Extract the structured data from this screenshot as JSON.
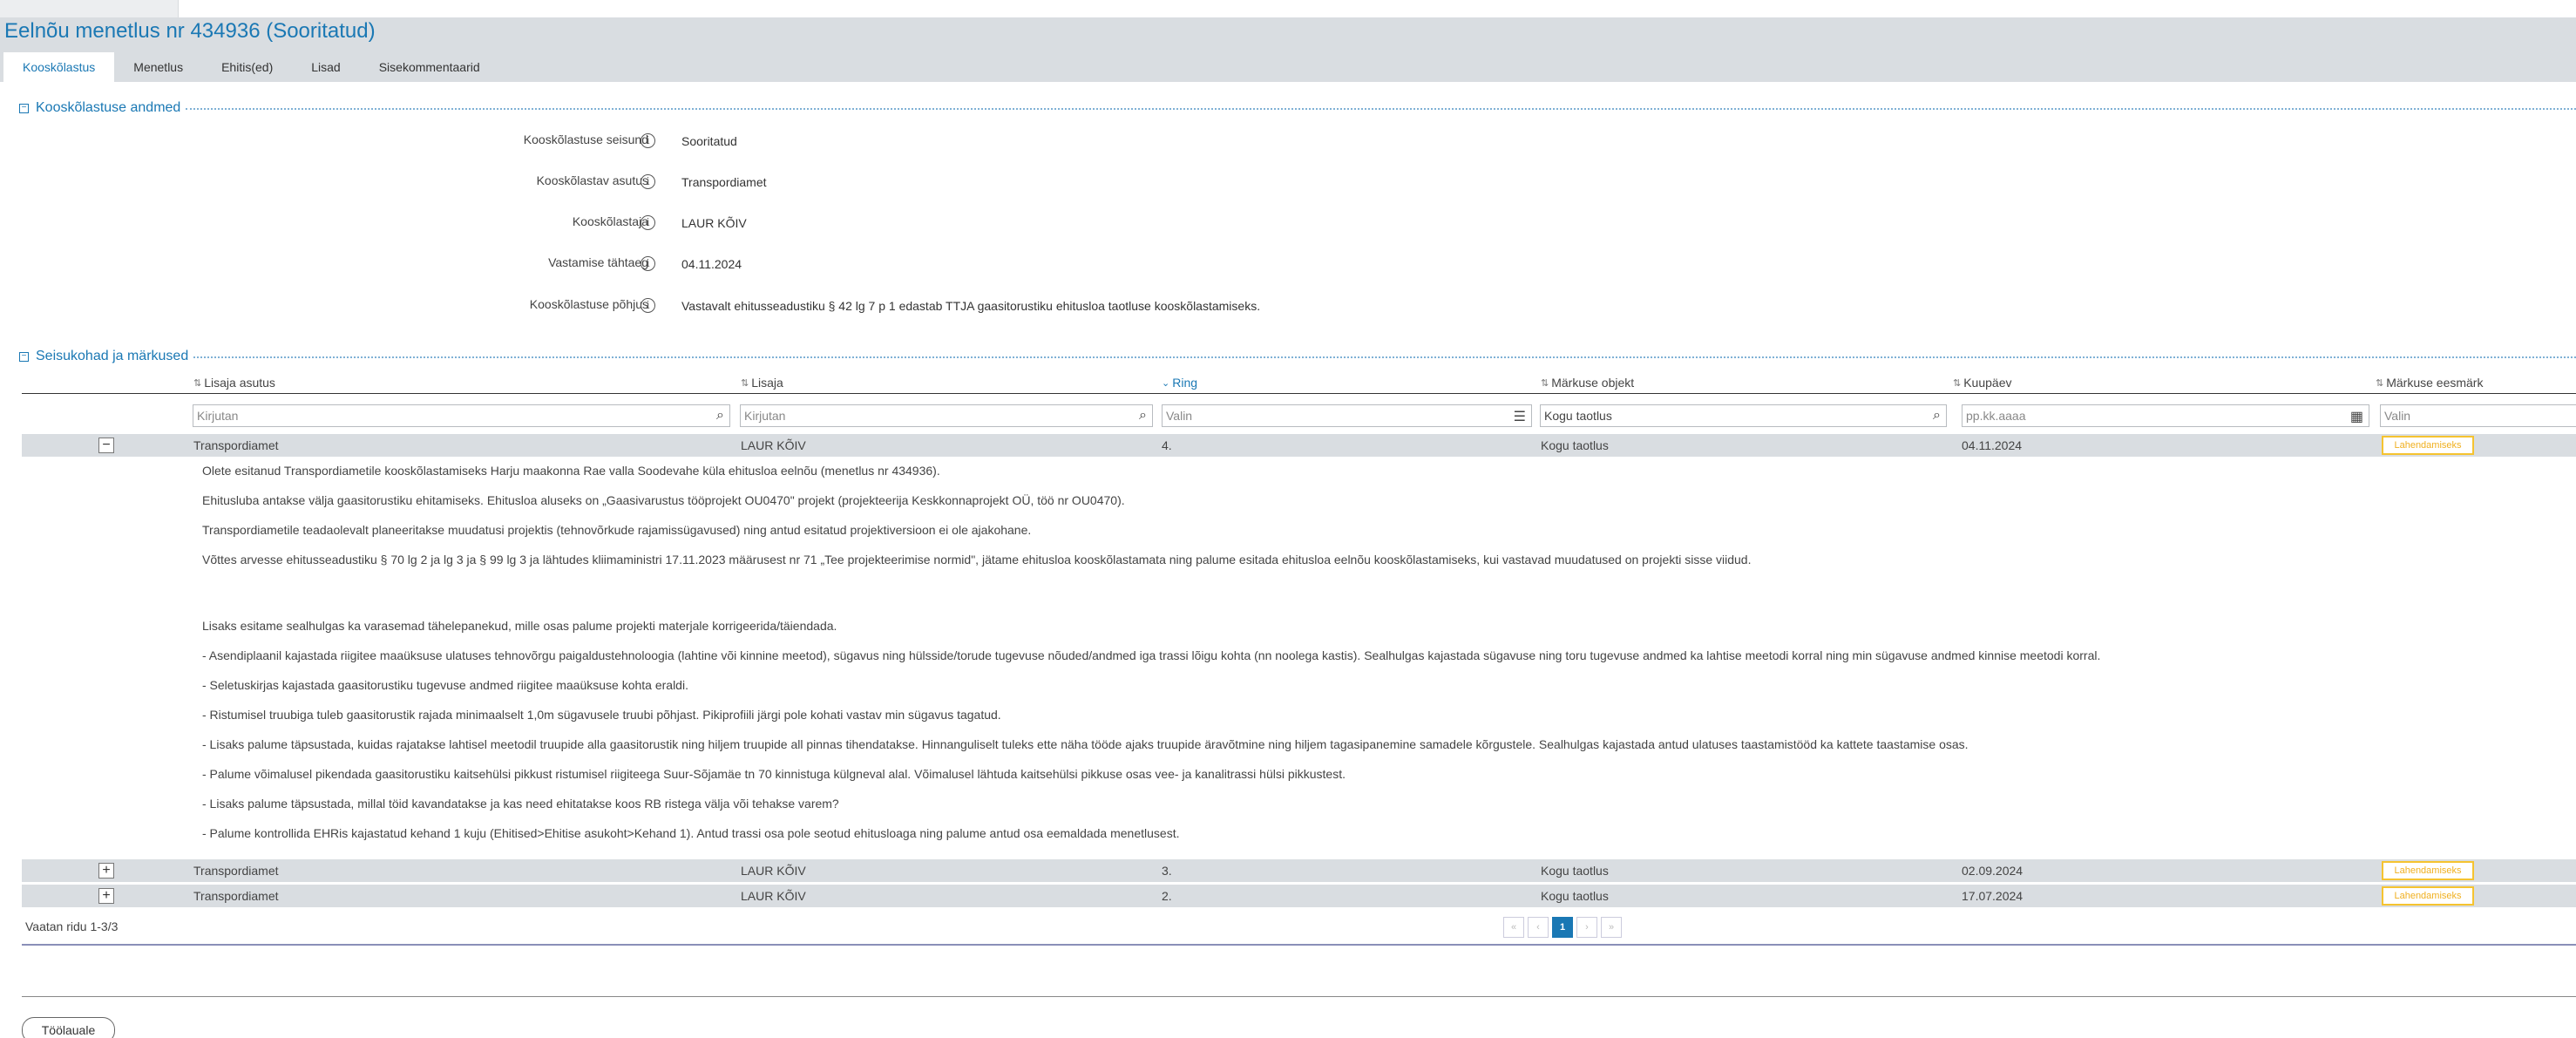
{
  "page_title": "Eelnõu menetlus nr 434936 (Sooritatud)",
  "tabs": [
    {
      "label": "Kooskõlastus"
    },
    {
      "label": "Menetlus"
    },
    {
      "label": "Ehitis(ed)"
    },
    {
      "label": "Lisad"
    },
    {
      "label": "Sisekommentaarid"
    }
  ],
  "section1": {
    "title": "Kooskõlastuse andmed",
    "toggle": "−",
    "fields": [
      {
        "label": "Kooskõlastuse seisund",
        "value": "Sooritatud"
      },
      {
        "label": "Kooskõlastav asutus",
        "value": "Transpordiamet"
      },
      {
        "label": "Kooskõlastaja",
        "value": "LAUR KÕIV"
      },
      {
        "label": "Vastamise tähtaeg",
        "value": "04.11.2024"
      },
      {
        "label": "Kooskõlastuse põhjus",
        "value": "Vastavalt ehitusseadustiku § 42 lg 7 p 1 edastab TTJA gaasitorustiku ehitusloa taotluse kooskõlastamiseks."
      }
    ]
  },
  "section2": {
    "title": "Seisukohad ja märkused",
    "toggle": "−"
  },
  "grid": {
    "columns": [
      "Lisaja asutus",
      "Lisaja",
      "Ring",
      "Märkuse objekt",
      "Kuupäev",
      "Märkuse eesmärk"
    ],
    "filters": [
      {
        "placeholder": "Kirjutan",
        "icon": "search-icon"
      },
      {
        "placeholder": "Kirjutan",
        "icon": "search-icon"
      },
      {
        "placeholder": "Valin",
        "icon": "list-icon"
      },
      {
        "value": "Kogu taotlus",
        "icon": "search-icon"
      },
      {
        "placeholder": "pp.kk.aaaa",
        "icon": "calendar-icon"
      },
      {
        "placeholder": "Valin"
      }
    ],
    "rows": [
      {
        "toggle": "−",
        "asutus": "Transpordiamet",
        "lisaja": "LAUR KÕIV",
        "ring": "4.",
        "objekt": "Kogu taotlus",
        "kuupaev": "04.11.2024",
        "eesmark": "Lahendamiseks"
      },
      {
        "toggle": "+",
        "asutus": "Transpordiamet",
        "lisaja": "LAUR KÕIV",
        "ring": "3.",
        "objekt": "Kogu taotlus",
        "kuupaev": "02.09.2024",
        "eesmark": "Lahendamiseks"
      },
      {
        "toggle": "+",
        "asutus": "Transpordiamet",
        "lisaja": "LAUR KÕIV",
        "ring": "2.",
        "objekt": "Kogu taotlus",
        "kuupaev": "17.07.2024",
        "eesmark": "Lahendamiseks"
      }
    ],
    "detail": [
      "Olete esitanud Transpordiametile kooskõlastamiseks Harju maakonna Rae valla Soodevahe küla ehitusloa eelnõu (menetlus nr 434936).",
      "Ehitusluba antakse välja gaasitorustiku ehitamiseks. Ehitusloa aluseks on „Gaasivarustus tööprojekt OU0470\" projekt (projekteerija Keskkonnaprojekt OÜ, töö nr OU0470).",
      "Transpordiametile teadaolevalt planeeritakse muudatusi projektis (tehnovõrkude rajamissügavused) ning antud esitatud projektiversioon ei ole ajakohane.",
      "Võttes arvesse ehitusseadustiku § 70 lg 2 ja lg 3 ja § 99 lg 3 ja lähtudes kliimaministri 17.11.2023 määrusest nr 71 „Tee projekteerimise normid\", jätame ehitusloa kooskõlastamata ning palume esitada ehitusloa eelnõu kooskõlastamiseks, kui vastavad muudatused on projekti sisse viidud.",
      "Lisaks esitame sealhulgas ka varasemad tähelepanekud, mille osas palume projekti materjale korrigeerida/täiendada.",
      "-  Asendiplaanil kajastada riigitee maaüksuse ulatuses tehnovõrgu paigaldustehnoloogia (lahtine või kinnine meetod), sügavus ning hülsside/torude tugevuse nõuded/andmed iga trassi lõigu kohta (nn noolega kastis). Sealhulgas kajastada sügavuse ning toru tugevuse andmed ka lahtise meetodi korral ning min sügavuse andmed kinnise meetodi korral.",
      "- Seletuskirjas kajastada gaasitorustiku tugevuse andmed riigitee maaüksuse kohta eraldi.",
      "-  Ristumisel truubiga tuleb gaasitorustik rajada minimaalselt 1,0m sügavusele truubi põhjast. Pikiprofiili järgi pole kohati vastav min sügavus tagatud.",
      "-  Lisaks palume täpsustada, kuidas rajatakse lahtisel meetodil truupide alla gaasitorustik ning hiljem truupide all pinnas tihendatakse. Hinnanguliselt tuleks ette näha tööde ajaks truupide äravõtmine ning hiljem tagasipanemine samadele kõrgustele. Sealhulgas kajastada antud ulatuses taastamistööd ka kattete taastamise osas.",
      "-  Palume võimalusel pikendada gaasitorustiku kaitsehülsi pikkust ristumisel riigiteega Suur-Sõjamäe tn 70 kinnistuga külgneval alal. Võimalusel lähtuda kaitsehülsi pikkuse osas vee- ja kanalitrassi hülsi pikkustest.",
      "-  Lisaks palume täpsustada, millal töid kavandatakse ja kas need ehitatakse koos RB ristega välja või tehakse varem?",
      "-  Palume kontrollida EHRis kajastatud kehand 1 kuju (Ehitised>Ehitise asukoht>Kehand 1). Antud trassi osa pole seotud ehitusloaga ning palume antud osa eemaldada menetlusest."
    ],
    "footer": "Vaatan ridu 1-3/3",
    "pager": {
      "first": "«",
      "prev": "‹",
      "current": "1",
      "next": "›",
      "last": "»"
    }
  },
  "back_button": "Töölauale"
}
